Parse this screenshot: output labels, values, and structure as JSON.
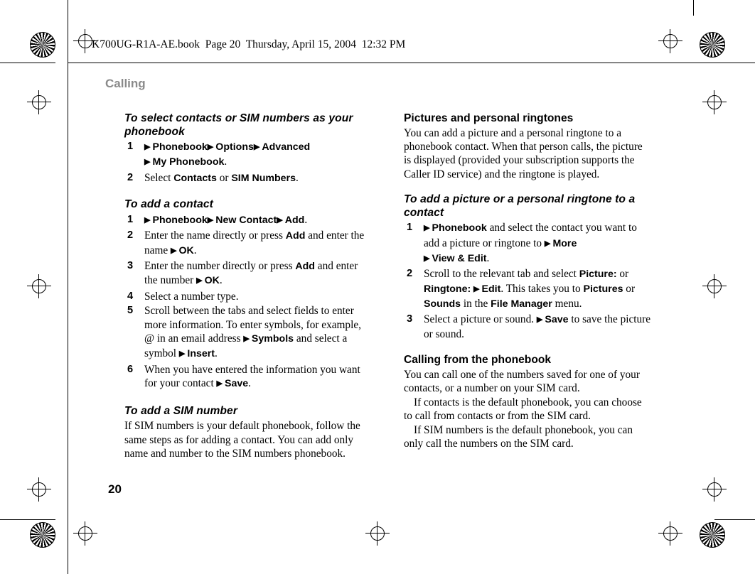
{
  "header": {
    "file_info": "K700UG-R1A-AE.book  Page 20  Thursday, April 15, 2004  12:32 PM"
  },
  "chapter": "Calling",
  "page_number": "20",
  "arrow": "▶",
  "left_column": {
    "section1": {
      "title": "To select contacts or SIM numbers as your phonebook",
      "steps": [
        {
          "num": "1",
          "parts": [
            {
              "t": "arrow"
            },
            {
              "t": "ui",
              "v": "Phonebook"
            },
            {
              "t": "arrow"
            },
            {
              "t": "ui",
              "v": "Options"
            },
            {
              "t": "arrow"
            },
            {
              "t": "ui",
              "v": "Advanced"
            },
            {
              "t": "br"
            },
            {
              "t": "arrow"
            },
            {
              "t": "ui",
              "v": "My Phonebook"
            },
            {
              "t": "text",
              "v": "."
            }
          ]
        },
        {
          "num": "2",
          "parts": [
            {
              "t": "text",
              "v": "Select "
            },
            {
              "t": "ui",
              "v": "Contacts"
            },
            {
              "t": "text",
              "v": " or "
            },
            {
              "t": "ui",
              "v": "SIM Numbers"
            },
            {
              "t": "text",
              "v": "."
            }
          ]
        }
      ]
    },
    "section2": {
      "title": "To add a contact",
      "steps": [
        {
          "num": "1",
          "parts": [
            {
              "t": "arrow"
            },
            {
              "t": "ui",
              "v": "Phonebook"
            },
            {
              "t": "arrow"
            },
            {
              "t": "ui",
              "v": "New Contact"
            },
            {
              "t": "arrow"
            },
            {
              "t": "ui",
              "v": "Add"
            },
            {
              "t": "text",
              "v": "."
            }
          ]
        },
        {
          "num": "2",
          "parts": [
            {
              "t": "text",
              "v": "Enter the name directly or press "
            },
            {
              "t": "ui",
              "v": "Add"
            },
            {
              "t": "text",
              "v": " and enter the name "
            },
            {
              "t": "arrow"
            },
            {
              "t": "ui",
              "v": "OK"
            },
            {
              "t": "text",
              "v": "."
            }
          ]
        },
        {
          "num": "3",
          "parts": [
            {
              "t": "text",
              "v": "Enter the number directly or press "
            },
            {
              "t": "ui",
              "v": "Add"
            },
            {
              "t": "text",
              "v": " and enter the number "
            },
            {
              "t": "arrow"
            },
            {
              "t": "ui",
              "v": "OK"
            },
            {
              "t": "text",
              "v": "."
            }
          ]
        },
        {
          "num": "4",
          "parts": [
            {
              "t": "text",
              "v": "Select a number type."
            }
          ]
        },
        {
          "num": "5",
          "parts": [
            {
              "t": "text",
              "v": "Scroll between the tabs and select fields to enter more information. To enter symbols, for example, @ in an email address "
            },
            {
              "t": "arrow"
            },
            {
              "t": "ui",
              "v": "Symbols"
            },
            {
              "t": "text",
              "v": " and select a symbol "
            },
            {
              "t": "arrow"
            },
            {
              "t": "ui",
              "v": "Insert"
            },
            {
              "t": "text",
              "v": "."
            }
          ]
        },
        {
          "num": "6",
          "parts": [
            {
              "t": "text",
              "v": "When you have entered the information you want for your contact "
            },
            {
              "t": "arrow"
            },
            {
              "t": "ui",
              "v": "Save"
            },
            {
              "t": "text",
              "v": "."
            }
          ]
        }
      ]
    },
    "section3": {
      "title": "To add a SIM number",
      "body": "If SIM numbers is your default phonebook, follow the same steps as for adding a contact. You can add only name and number to the SIM numbers phonebook."
    }
  },
  "right_column": {
    "section1": {
      "title": "Pictures and personal ringtones",
      "body": "You can add a picture and a personal ringtone to a phonebook contact. When that person calls, the picture is displayed (provided your subscription supports the Caller ID service) and the ringtone is played."
    },
    "section2": {
      "title": "To add a picture or a personal ringtone to a contact",
      "steps": [
        {
          "num": "1",
          "parts": [
            {
              "t": "arrow"
            },
            {
              "t": "ui",
              "v": "Phonebook"
            },
            {
              "t": "text",
              "v": " and select the contact you want to add a picture or ringtone to "
            },
            {
              "t": "arrow"
            },
            {
              "t": "ui",
              "v": "More"
            },
            {
              "t": "br"
            },
            {
              "t": "arrow"
            },
            {
              "t": "ui",
              "v": "View & Edit"
            },
            {
              "t": "text",
              "v": "."
            }
          ]
        },
        {
          "num": "2",
          "parts": [
            {
              "t": "text",
              "v": "Scroll to the relevant tab and select "
            },
            {
              "t": "ui",
              "v": "Picture:"
            },
            {
              "t": "text",
              "v": " or "
            },
            {
              "t": "ui",
              "v": "Ringtone:"
            },
            {
              "t": "text",
              "v": " "
            },
            {
              "t": "arrow"
            },
            {
              "t": "ui",
              "v": "Edit"
            },
            {
              "t": "text",
              "v": ". This takes you to "
            },
            {
              "t": "ui",
              "v": "Pictures"
            },
            {
              "t": "text",
              "v": " or "
            },
            {
              "t": "ui",
              "v": "Sounds"
            },
            {
              "t": "text",
              "v": " in the "
            },
            {
              "t": "ui",
              "v": "File Manager"
            },
            {
              "t": "text",
              "v": " menu."
            }
          ]
        },
        {
          "num": "3",
          "parts": [
            {
              "t": "text",
              "v": "Select a picture or sound. "
            },
            {
              "t": "arrow"
            },
            {
              "t": "ui",
              "v": "Save"
            },
            {
              "t": "text",
              "v": " to save the picture or sound."
            }
          ]
        }
      ]
    },
    "section3": {
      "title": "Calling from the phonebook",
      "paragraphs": [
        "You can call one of the numbers saved for one of your contacts, or a number on your SIM card.",
        "If contacts is the default phonebook, you can choose to call from contacts or from the SIM card.",
        "If SIM numbers is the default phonebook, you can only call the numbers on the SIM card."
      ]
    }
  }
}
